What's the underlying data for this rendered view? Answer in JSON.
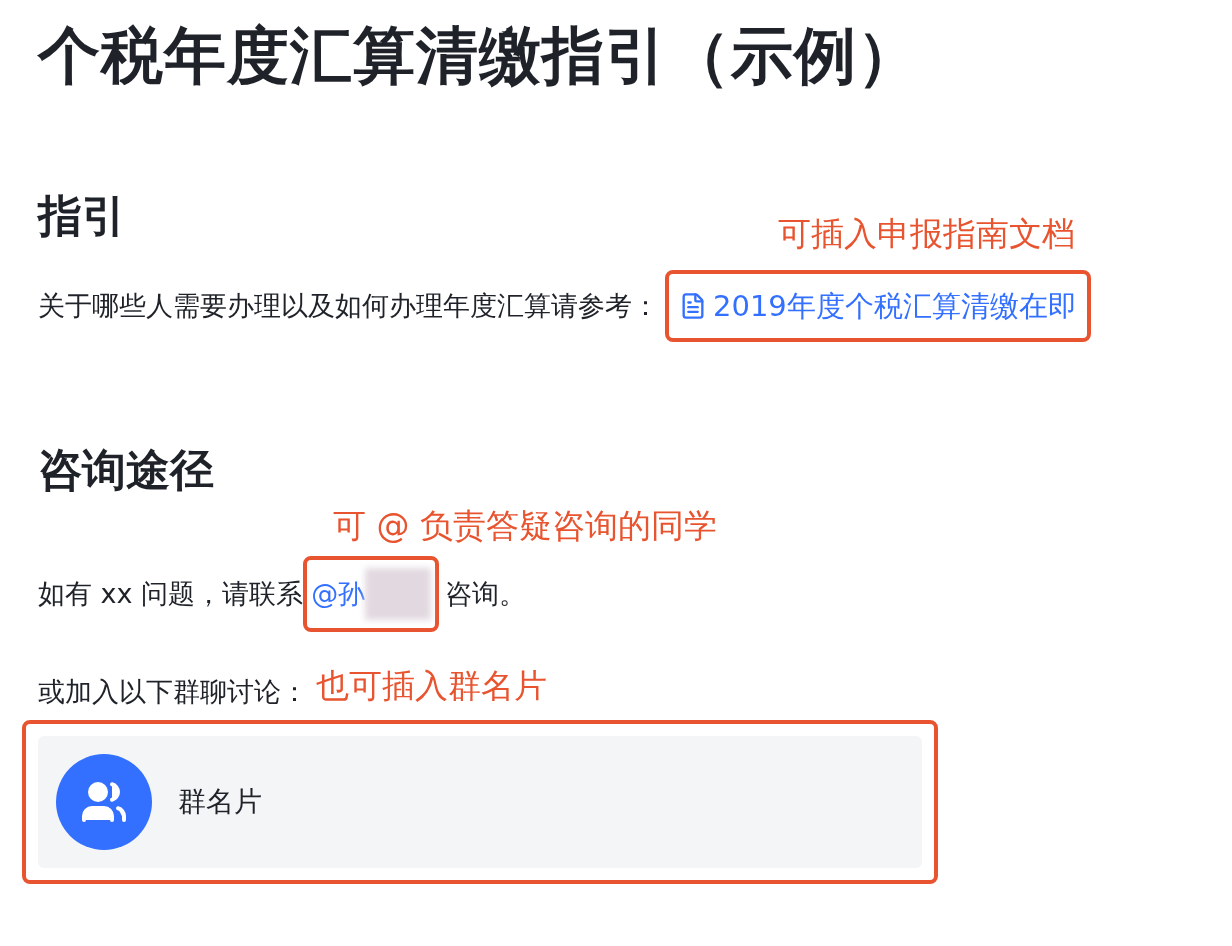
{
  "title": "个税年度汇算清缴指引（示例）",
  "guide": {
    "heading": "指引",
    "annotation": "可插入申报指南文档",
    "text": "关于哪些人需要办理以及如何办理年度汇算请参考：",
    "link": "2019年度个税汇算清缴在即"
  },
  "consult": {
    "heading": "咨询途径",
    "annotation": "可 @ 负责答疑咨询的同学",
    "before": "如有 xx 问题，请联系",
    "mention": "@孙",
    "after": "咨询。",
    "group_text": "或加入以下群聊讨论：",
    "group_annotation": "也可插入群名片",
    "group_card": {
      "name": "群名片"
    }
  }
}
